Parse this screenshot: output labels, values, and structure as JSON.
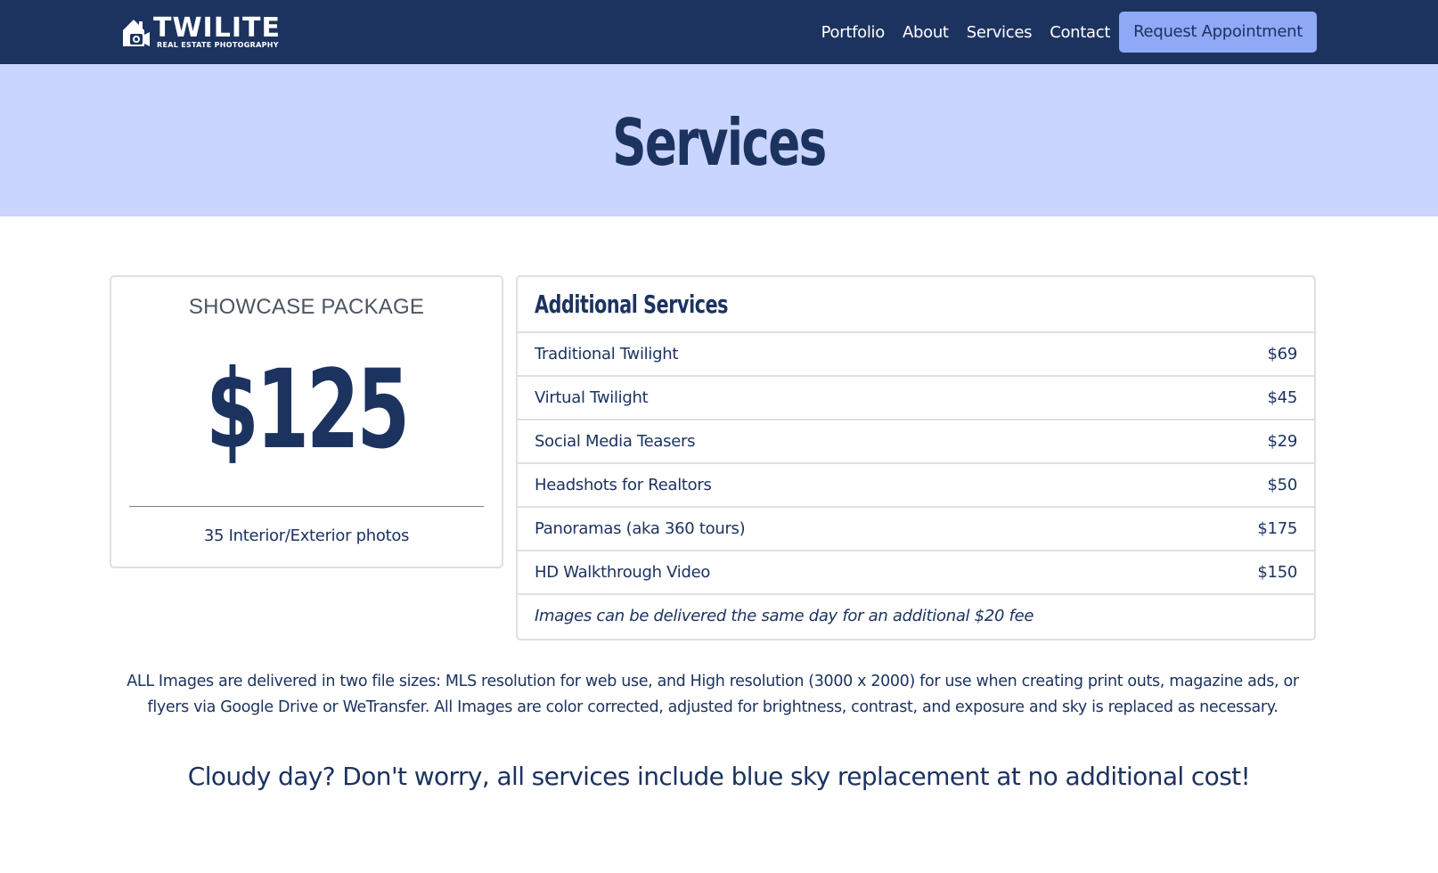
{
  "navbar": {
    "logo_main": "TWILITE",
    "logo_sub": "REAL ESTATE PHOTOGRAPHY",
    "links": [
      "Portfolio",
      "About",
      "Services",
      "Contact"
    ],
    "cta": "Request Appointment"
  },
  "hero": {
    "title": "Services"
  },
  "package": {
    "title": "SHOWCASE PACKAGE",
    "price": "$125",
    "description": "35 Interior/Exterior photos"
  },
  "additional": {
    "title": "Additional Services",
    "items": [
      {
        "name": "Traditional Twilight",
        "price": "$69"
      },
      {
        "name": "Virtual Twilight",
        "price": "$45"
      },
      {
        "name": "Social Media Teasers",
        "price": "$29"
      },
      {
        "name": "Headshots for Realtors",
        "price": "$50"
      },
      {
        "name": "Panoramas (aka 360 tours)",
        "price": "$175"
      },
      {
        "name": "HD Walkthrough Video",
        "price": "$150"
      }
    ],
    "note": "Images can be delivered the same day for an additional $20 fee"
  },
  "info_paragraph": "ALL Images are delivered in two file sizes: MLS resolution for web use, and High resolution (3000 x 2000) for use when creating print outs, magazine ads, or flyers via Google Drive or WeTransfer. All Images are color corrected, adjusted for brightness, contrast, and exposure and sky is replaced as necessary.",
  "cloudy_banner": "Cloudy day? Don't worry, all services include blue sky replacement at no additional cost!",
  "colors": {
    "navy": "#1c3360",
    "hero_bg": "#c9d5fe",
    "cta_bg": "#8fa9f7",
    "border": "#dcdfe6"
  }
}
